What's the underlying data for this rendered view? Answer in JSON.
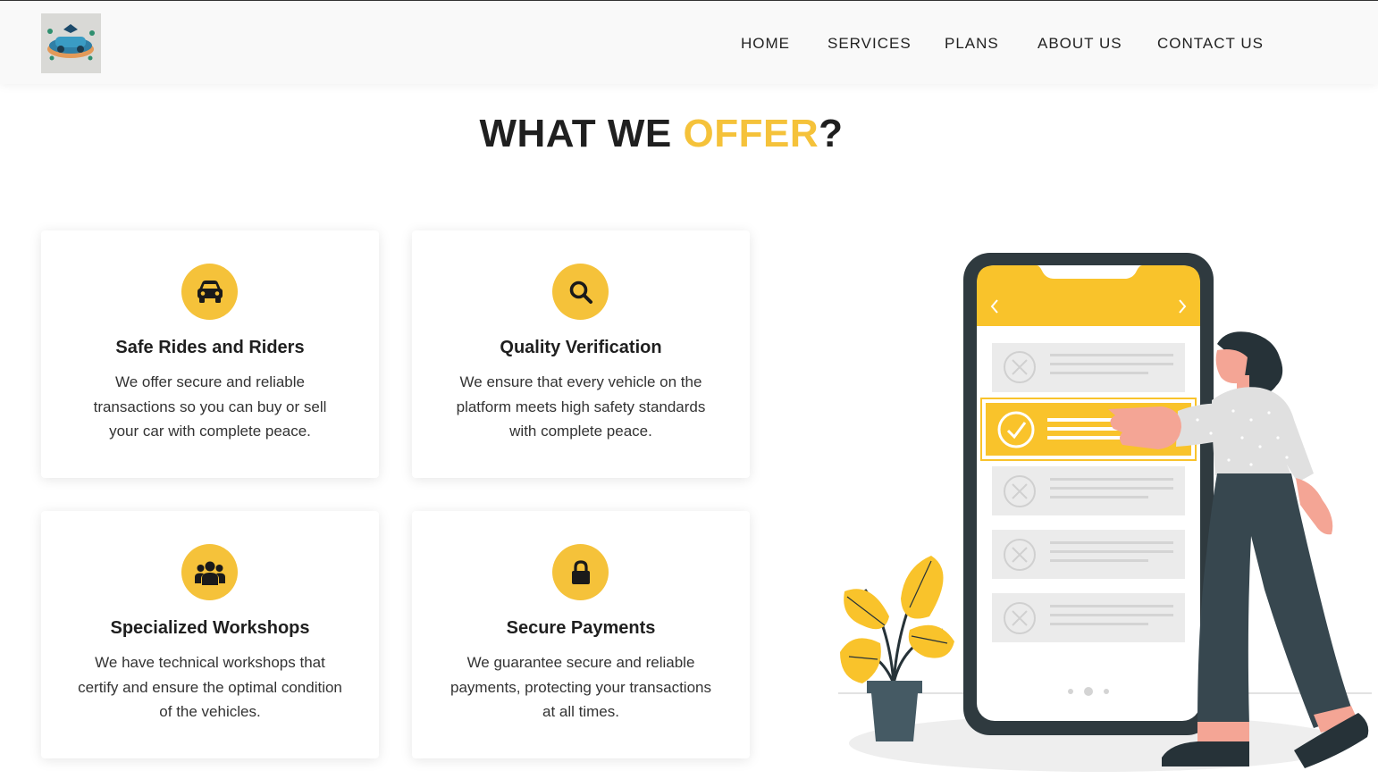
{
  "nav": {
    "items": [
      {
        "label": "HOME"
      },
      {
        "label": "SERVICES"
      },
      {
        "label": "PLANS"
      },
      {
        "label": "ABOUT US"
      },
      {
        "label": "CONTACT US"
      }
    ]
  },
  "section": {
    "title_part1": "WHAT WE ",
    "title_accent": "OFFER",
    "title_part2": "?"
  },
  "cards": [
    {
      "icon": "car-icon",
      "title": "Safe Rides and Riders",
      "text": "We offer secure and reliable transactions so you can buy or sell your car with complete peace."
    },
    {
      "icon": "search-icon",
      "title": "Quality Verification",
      "text": "We ensure that every vehicle on the platform meets high safety standards with complete peace."
    },
    {
      "icon": "users-icon",
      "title": "Specialized Workshops",
      "text": "We have technical workshops that certify and ensure the optimal condition of the vehicles."
    },
    {
      "icon": "lock-icon",
      "title": "Secure Payments",
      "text": "We guarantee secure and reliable payments, protecting your transactions at all times."
    }
  ],
  "colors": {
    "accent": "#f5c23a",
    "text_dark": "#1f1f1f",
    "phone_frame": "#2f3a3f"
  }
}
